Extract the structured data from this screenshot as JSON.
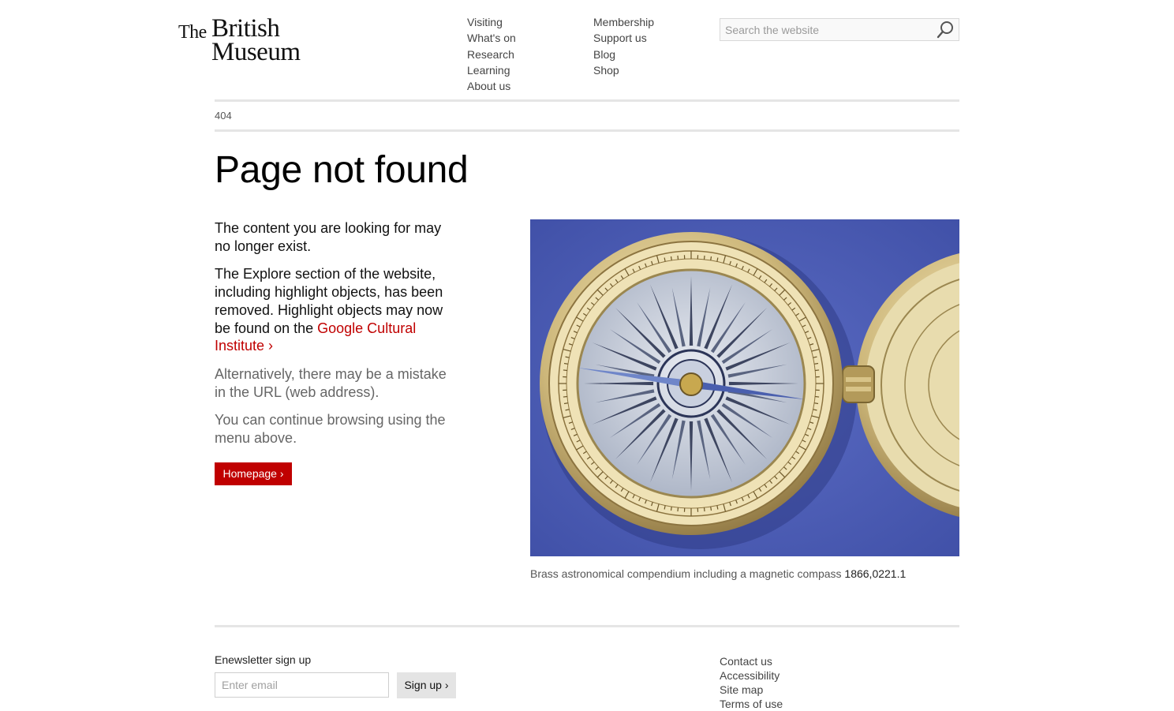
{
  "logo": {
    "the": "The",
    "line1": "British",
    "line2": "Museum"
  },
  "nav": {
    "col1": [
      "Visiting",
      "What's on",
      "Research",
      "Learning",
      "About us"
    ],
    "col2": [
      "Membership",
      "Support us",
      "Blog",
      "Shop"
    ]
  },
  "search": {
    "placeholder": "Search the website",
    "icon": "search-icon"
  },
  "breadcrumb": "404",
  "page_title": "Page not found",
  "content": {
    "p1": "The content you are looking for may no longer exist.",
    "p2_text": "The Explore section of the website, including highlight objects, has been removed. Highlight objects may now be found on the",
    "p2_link": "Google Cultural Institute ›",
    "p3": "Alternatively, there may be a mistake in the URL (web address).",
    "p4": "You can continue browsing using the menu above.",
    "home_button": "Homepage ›"
  },
  "figure": {
    "caption": "Brass astronomical compendium including a magnetic compass",
    "reg_number": "1866,0221.1"
  },
  "footer": {
    "newsletter_label": "Enewsletter sign up",
    "email_placeholder": "Enter email",
    "signup_button": "Sign up ›",
    "links": [
      "Contact us",
      "Accessibility",
      "Site map",
      "Terms of use"
    ]
  },
  "colors": {
    "accent": "#c00000",
    "image_bg": "#4f61b8",
    "rule": "#e5e5e5"
  }
}
